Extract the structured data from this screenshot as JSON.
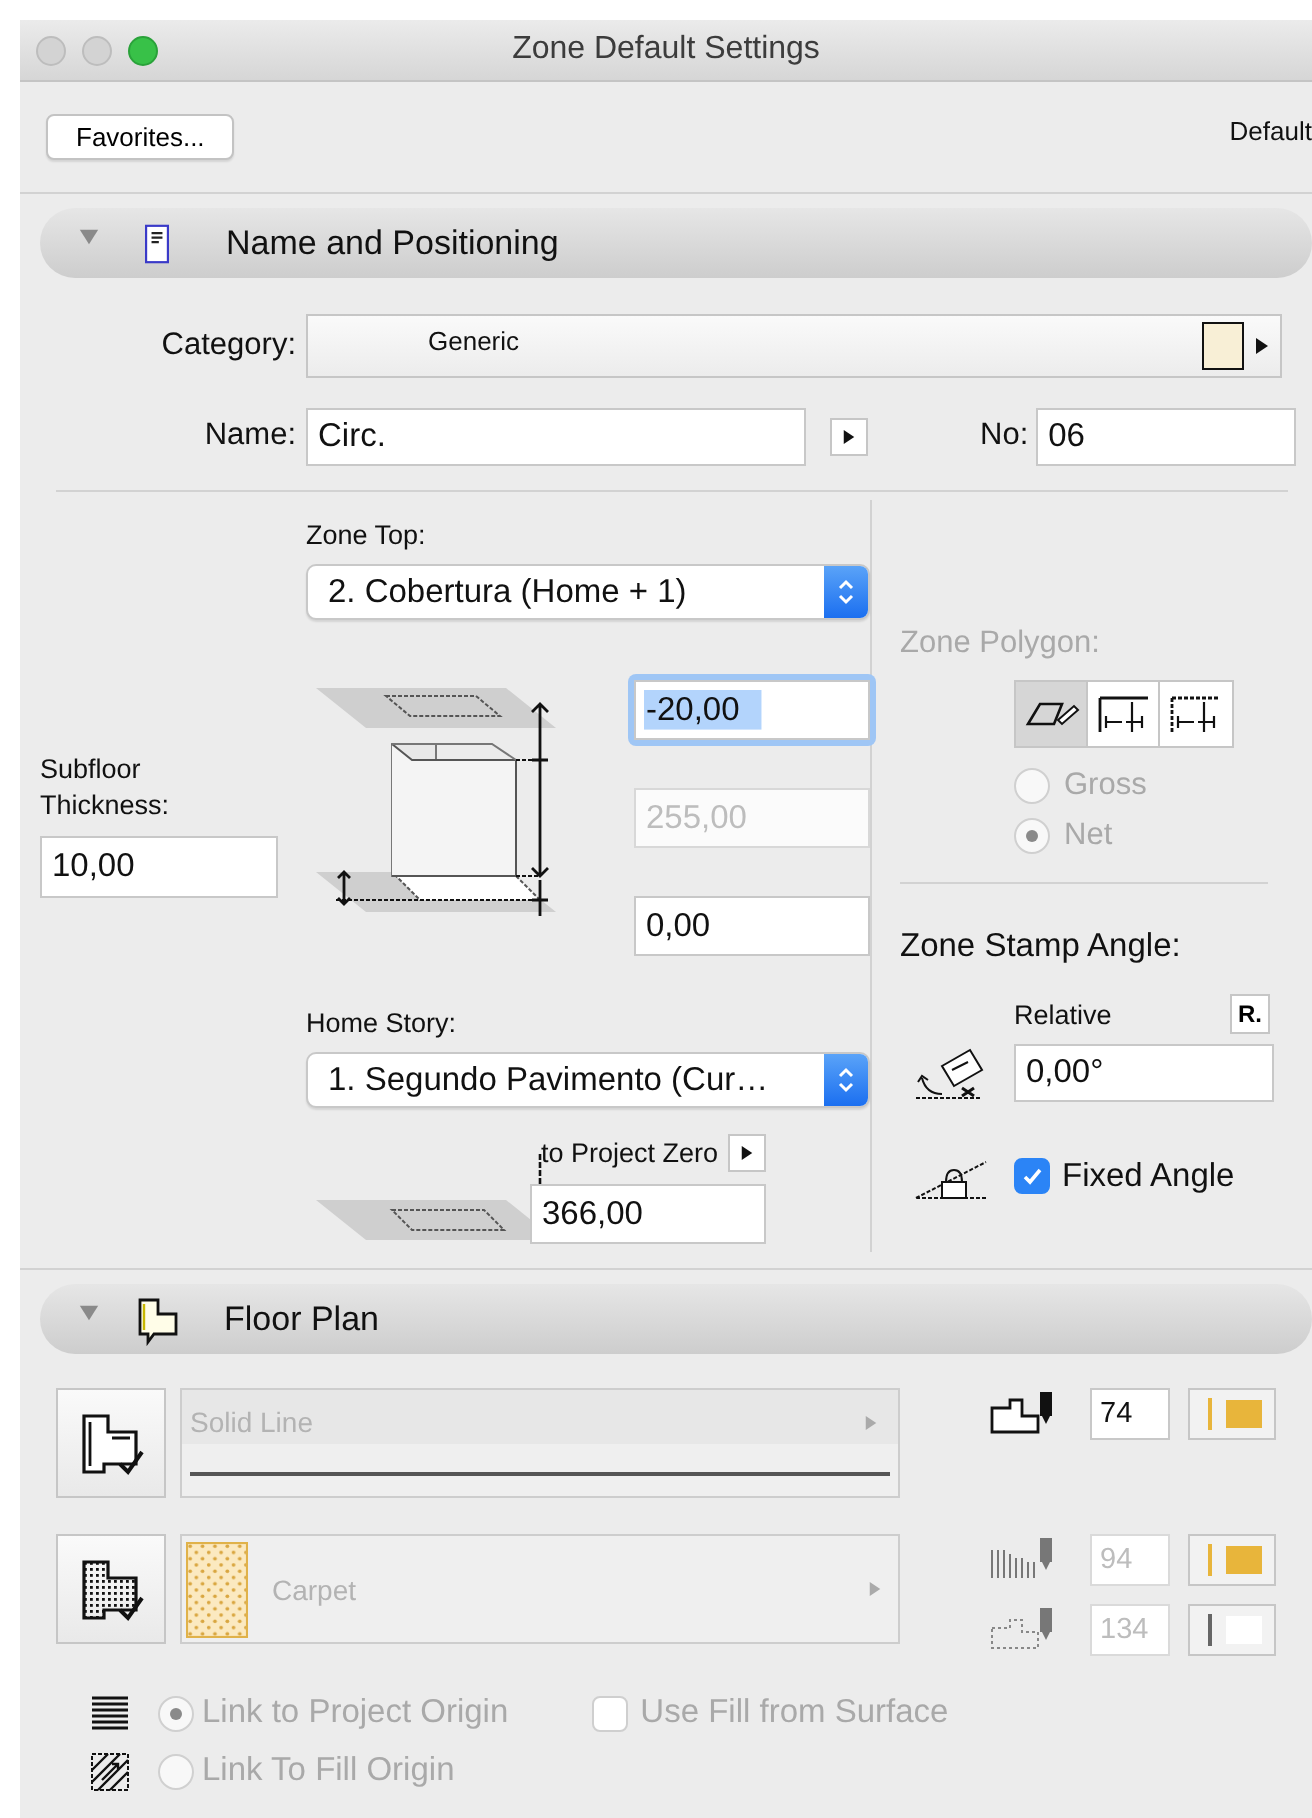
{
  "window": {
    "title": "Zone Default Settings"
  },
  "toolbar": {
    "favorites": "Favorites...",
    "preset": "Default"
  },
  "name_and_positioning": {
    "title": "Name and Positioning",
    "expanded": true,
    "category": {
      "label": "Category:",
      "value": "Generic"
    },
    "name": {
      "label": "Name:",
      "value": "Circ."
    },
    "number": {
      "label": "No:",
      "value": "06"
    },
    "zone_top": {
      "label": "Zone Top:",
      "value": "2. Cobertura (Home + 1)"
    },
    "offsets": [
      {
        "value": "-20,00",
        "focused": true,
        "disabled": false
      },
      {
        "value": "255,00",
        "focused": false,
        "disabled": true
      },
      {
        "value": "0,00",
        "focused": false,
        "disabled": false
      }
    ],
    "subfloor": {
      "label": "Subfloor Thickness:",
      "value": "10,00"
    },
    "home_story": {
      "label": "Home Story:",
      "value": "1. Segundo Pavimento (Cur…"
    },
    "project_zero": {
      "label": "to Project Zero",
      "value": "366,00"
    },
    "zone_polygon": {
      "label": "Zone Polygon:",
      "disabled": true,
      "tools": [
        {
          "selected": true
        },
        {
          "selected": false
        },
        {
          "selected": false
        }
      ],
      "options": [
        {
          "label": "Gross",
          "selected": false
        },
        {
          "label": "Net",
          "selected": true
        }
      ]
    },
    "stamp_angle": {
      "title": "Zone Stamp Angle:",
      "relative": "Relative",
      "relative_button": "R.",
      "value": "0,00°",
      "fixed_angle": {
        "label": "Fixed Angle",
        "checked": true
      }
    }
  },
  "floor_plan": {
    "title": "Floor Plan",
    "expanded": true,
    "line": {
      "name": "Solid Line",
      "disabled": true
    },
    "fill": {
      "name": "Carpet",
      "disabled": true
    },
    "pens": [
      {
        "kind": "line",
        "value": "74",
        "color": "#e8b53b",
        "disabled": false
      },
      {
        "kind": "fill",
        "value": "94",
        "color": "#e8b53b",
        "disabled": true
      },
      {
        "kind": "background",
        "value": "134",
        "color": "#ffffff",
        "disabled": true
      }
    ],
    "origins": [
      {
        "label": "Link to Project Origin",
        "selected": true,
        "disabled": true
      },
      {
        "label": "Link To Fill Origin",
        "selected": false,
        "disabled": true
      }
    ],
    "use_fill_from_surface": {
      "label": "Use Fill from Surface",
      "checked": false,
      "disabled": true
    }
  }
}
